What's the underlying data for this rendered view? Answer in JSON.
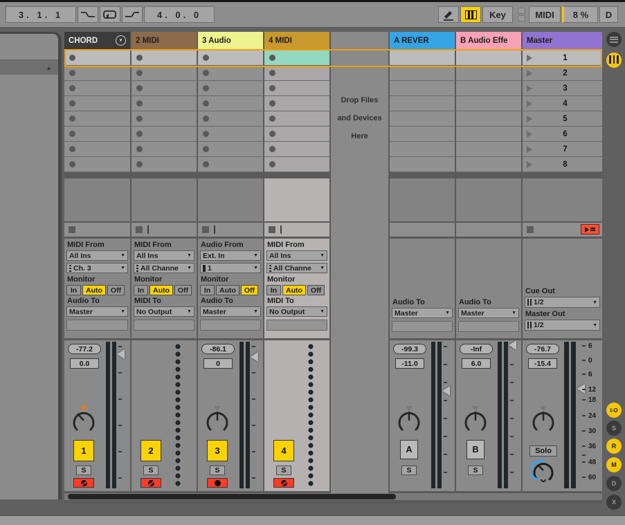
{
  "transport": {
    "loop_start": "3. 1. 1",
    "loop_length": "4. 0. 0",
    "key": "Key",
    "midi": "MIDI",
    "cpu": "8 %",
    "disk": "D"
  },
  "icons": {
    "caret": "▼",
    "triangle_up": "▲"
  },
  "io_labels": {
    "monitor": "Monitor",
    "in": "In",
    "auto": "Auto",
    "off": "Off"
  },
  "tracks": [
    {
      "name": "CHORD",
      "color": "#3b3b3b",
      "io": {
        "src_label": "MIDI From",
        "src": "All Ins",
        "ch": "Ch. 3",
        "dest_label": "Audio To",
        "dest": "Master"
      },
      "mixer": {
        "peak": "-77.2",
        "vol": "0.0",
        "num": "1",
        "solo": "S"
      }
    },
    {
      "name": "2 MIDI",
      "color": "#8d6b4c",
      "io": {
        "src_label": "MIDI From",
        "src": "All Ins",
        "ch": "All Channe",
        "dest_label": "MIDI To",
        "dest": "No Output"
      },
      "mixer": {
        "num": "2",
        "solo": "S"
      }
    },
    {
      "name": "3 Audio",
      "color": "#eef28f",
      "io": {
        "src_label": "Audio From",
        "src": "Ext. In",
        "ch": "1",
        "dest_label": "Audio To",
        "dest": "Master"
      },
      "mixer": {
        "peak": "-86.1",
        "vol": "0",
        "num": "3",
        "solo": "S"
      }
    },
    {
      "name": "4 MIDI",
      "color": "#c9992e",
      "io": {
        "src_label": "MIDI From",
        "src": "All Ins",
        "ch": "All Channe",
        "dest_label": "MIDI To",
        "dest": "No Output"
      },
      "mixer": {
        "num": "4",
        "solo": "S"
      }
    }
  ],
  "drop_zone": {
    "line1": "Drop Files",
    "line2": "and Devices",
    "line3": "Here"
  },
  "returns": [
    {
      "name": "A REVER",
      "color": "#35a5e5",
      "io": {
        "dest_label": "Audio To",
        "dest": "Master"
      },
      "mixer": {
        "peak": "-99.3",
        "vol": "-11.0",
        "btn": "A",
        "solo": "S"
      }
    },
    {
      "name": "B Audio Effe",
      "color": "#f5a2b4",
      "io": {
        "dest_label": "Audio To",
        "dest": "Master"
      },
      "mixer": {
        "peak": "-Inf",
        "vol": "6.0",
        "btn": "B",
        "solo": "S"
      }
    }
  ],
  "master": {
    "name": "Master",
    "color": "#9173d2",
    "scenes": [
      "1",
      "2",
      "3",
      "4",
      "5",
      "6",
      "7",
      "8"
    ],
    "io": {
      "cue_label": "Cue Out",
      "cue": "1/2",
      "out_label": "Master Out",
      "out": "1/2"
    },
    "mixer": {
      "peak": "-76.7",
      "vol": "-15.4",
      "solo": "Solo",
      "scale": [
        "6",
        "0",
        "6",
        "12",
        "18",
        "24",
        "30",
        "36",
        "48",
        "60"
      ]
    }
  },
  "side_buttons": {
    "io": "I-O",
    "sends": "S",
    "returns": "R",
    "mixer": "M",
    "delay": "D",
    "crossfader": "X"
  },
  "colors": {
    "selection": "#f2a007",
    "clip_selected": "#93d8c1",
    "record": "#ff3a28",
    "button_yellow": "#fbd303"
  }
}
